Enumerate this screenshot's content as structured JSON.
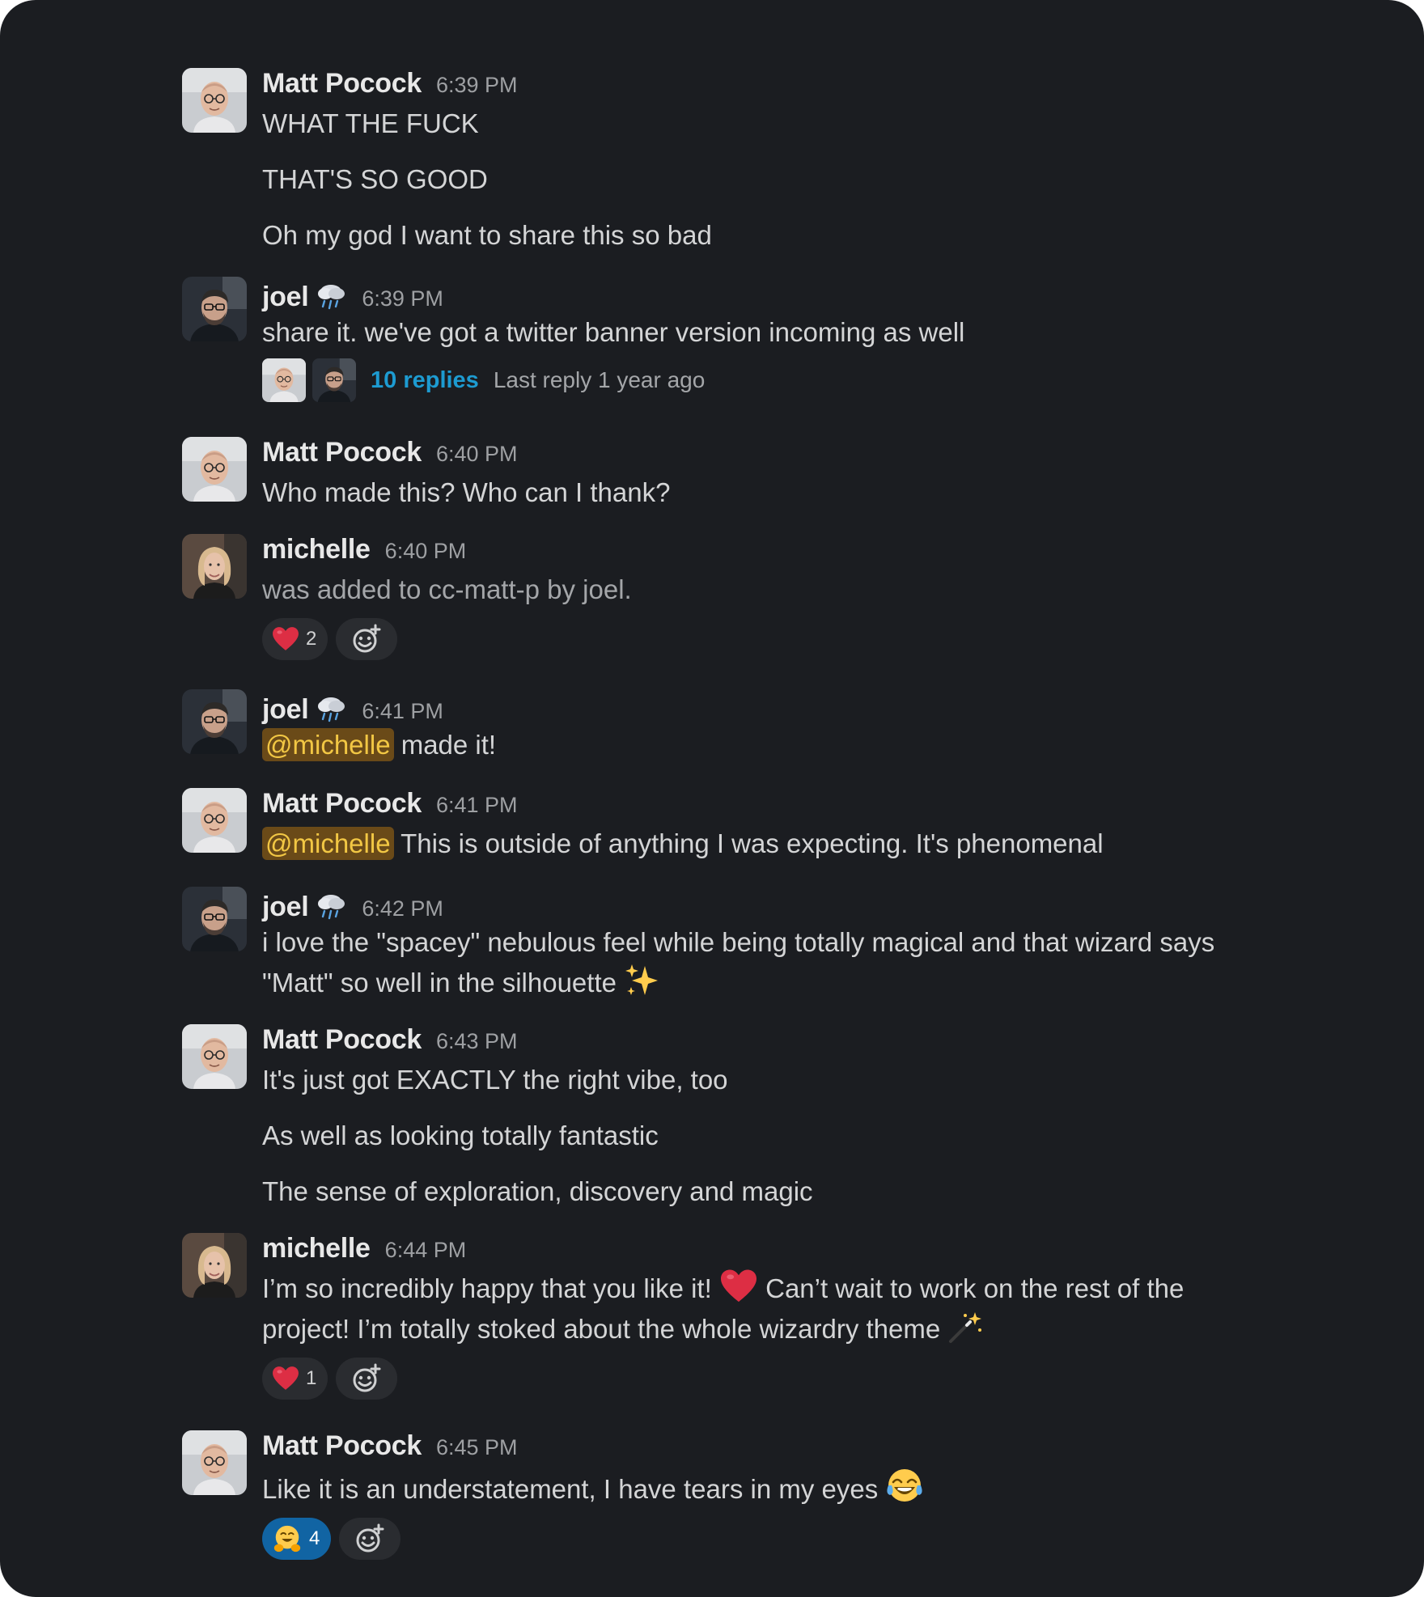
{
  "messages": [
    {
      "author": "Matt Pocock",
      "avatar": "matt",
      "time": "6:39 PM",
      "lines": [
        "WHAT THE FUCK",
        "THAT'S SO GOOD",
        "Oh my god I want to share this so bad"
      ]
    },
    {
      "author": "joel",
      "status_emoji": "cloud-with-rain",
      "avatar": "joel",
      "time": "6:39 PM",
      "lines": [
        "share it. we've got a twitter banner version incoming as well"
      ],
      "thread": {
        "replies": "10 replies",
        "last_reply": "Last reply 1 year ago"
      }
    },
    {
      "author": "Matt Pocock",
      "avatar": "matt",
      "time": "6:40 PM",
      "lines": [
        "Who made this? Who can I thank?"
      ]
    },
    {
      "author": "michelle",
      "avatar": "michelle",
      "time": "6:40 PM",
      "lines": [
        "was added to cc-matt-p by joel."
      ],
      "reactions": [
        {
          "emoji": "heart",
          "count": "2"
        }
      ]
    },
    {
      "author": "joel",
      "status_emoji": "cloud-with-rain",
      "avatar": "joel",
      "time": "6:41 PM",
      "mention": "@michelle",
      "text_after_mention": " made it!"
    },
    {
      "author": "Matt Pocock",
      "avatar": "matt",
      "time": "6:41 PM",
      "mention": "@michelle",
      "text_after_mention": " This is outside of anything I was expecting. It's phenomenal"
    },
    {
      "author": "joel",
      "status_emoji": "cloud-with-rain",
      "avatar": "joel",
      "time": "6:42 PM",
      "lines": [
        "i love the \"spacey\" nebulous feel while being totally magical and that wizard says",
        "\"Matt\" so well in the silhouette"
      ],
      "trailing_emoji": "sparkles"
    },
    {
      "author": "Matt Pocock",
      "avatar": "matt",
      "time": "6:43 PM",
      "lines": [
        "It's just got EXACTLY the right vibe, too",
        "As well as looking totally fantastic",
        "The sense of exploration, discovery and magic"
      ]
    },
    {
      "author": "michelle",
      "avatar": "michelle",
      "time": "6:44 PM",
      "line1_a": "I’m so incredibly happy that you like it! ",
      "line1_emoji": "heart",
      "line1_b": " Can’t wait to work on the rest of the",
      "line2": "project! I’m totally stoked about the whole wizardry theme ",
      "line2_emoji": "magic-wand",
      "reactions": [
        {
          "emoji": "heart",
          "count": "1"
        }
      ]
    },
    {
      "author": "Matt Pocock",
      "avatar": "matt",
      "time": "6:45 PM",
      "lines": [
        "Like it is an understatement, I have tears in my eyes "
      ],
      "trailing_emoji": "joy",
      "reactions": [
        {
          "emoji": "hugging-face",
          "count": "4",
          "active": true
        }
      ]
    }
  ],
  "colors": {
    "background": "#1b1d21",
    "link": "#1d9bd1",
    "mention_bg": "#6a4a18",
    "mention_text": "#f2c744",
    "reaction_active": "#1164a3"
  }
}
